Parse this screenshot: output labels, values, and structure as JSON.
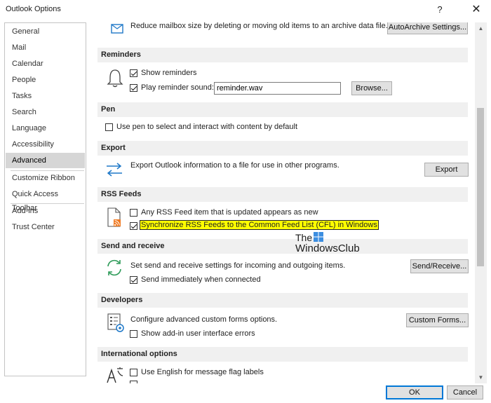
{
  "window": {
    "title": "Outlook Options",
    "help_label": "?",
    "close_label": "✕"
  },
  "nav": {
    "items": [
      "General",
      "Mail",
      "Calendar",
      "People",
      "Tasks",
      "Search",
      "Language",
      "Accessibility",
      "Advanced",
      "Customize Ribbon",
      "Quick Access Toolbar",
      "Add-ins",
      "Trust Center"
    ],
    "selected": "Advanced"
  },
  "autoarchive": {
    "text": "Reduce mailbox size by deleting or moving old items to an archive data file.",
    "button": "AutoArchive Settings..."
  },
  "reminders": {
    "header": "Reminders",
    "show_label": "Show reminders",
    "show_checked": true,
    "play_label": "Play reminder sound:",
    "play_checked": true,
    "sound_file": "reminder.wav",
    "browse_button": "Browse..."
  },
  "pen": {
    "header": "Pen",
    "label": "Use pen to select and interact with content by default",
    "checked": false
  },
  "export": {
    "header": "Export",
    "text": "Export Outlook information to a file for use in other programs.",
    "button": "Export"
  },
  "rss": {
    "header": "RSS Feeds",
    "item1_label": "Any RSS Feed item that is updated appears as new",
    "item1_checked": false,
    "item2_label": "Synchronize RSS Feeds to the Common Feed List (CFL) in Windows",
    "item2_checked": true
  },
  "send_receive": {
    "header": "Send and receive",
    "text": "Set send and receive settings for incoming and outgoing items.",
    "button": "Send/Receive...",
    "immediate_label": "Send immediately when connected",
    "immediate_checked": true
  },
  "developers": {
    "header": "Developers",
    "text": "Configure advanced custom forms options.",
    "button": "Custom Forms...",
    "addin_label": "Show add-in user interface errors",
    "addin_checked": false
  },
  "international": {
    "header": "International options",
    "english_label": "Use English for message flag labels",
    "english_checked": false
  },
  "footer": {
    "ok": "OK",
    "cancel": "Cancel"
  },
  "watermark": {
    "line1": "The",
    "line2": "WindowsClub"
  },
  "colors": {
    "highlight": "#ffff00",
    "selected_nav": "#d6d6d6",
    "header_bg": "#f0f0f0",
    "ok_border": "#0078d7",
    "icon_blue": "#1e78c8",
    "icon_green": "#2e9b59"
  }
}
